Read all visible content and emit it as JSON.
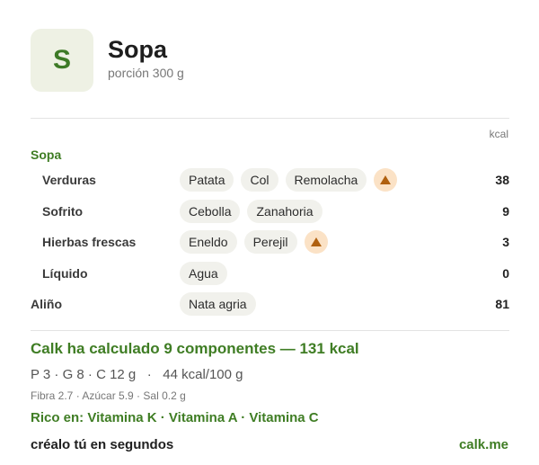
{
  "header": {
    "avatar_letter": "S",
    "title": "Sopa",
    "subtitle": "porción 300 g"
  },
  "table": {
    "kcal_header": "kcal",
    "section_title": "Sopa",
    "rows": [
      {
        "label": "Verduras",
        "chips": [
          "Patata",
          "Col",
          "Remolacha"
        ],
        "warning": true,
        "kcal": "38"
      },
      {
        "label": "Sofrito",
        "chips": [
          "Cebolla",
          "Zanahoria"
        ],
        "warning": false,
        "kcal": "9"
      },
      {
        "label": "Hierbas frescas",
        "chips": [
          "Eneldo",
          "Perejil"
        ],
        "warning": true,
        "kcal": "3"
      },
      {
        "label": "Líquido",
        "chips": [
          "Agua"
        ],
        "warning": false,
        "kcal": "0"
      },
      {
        "label": "Aliño",
        "chips": [
          "Nata agria"
        ],
        "warning": false,
        "kcal": "81"
      }
    ]
  },
  "summary": {
    "headline": "Calk ha calculado 9 componentes — 131 kcal",
    "macros": "P 3 · G 8 · C 12 g   ·   44 kcal/100 g",
    "micros": "Fibra 2.7 · Azúcar 5.9 · Sal 0.2 g",
    "rich_in": "Rico en: Vitamina K · Vitamina A · Vitamina C"
  },
  "footer": {
    "cta": "créalo tú en segundos",
    "link": "calk.me"
  },
  "colors": {
    "accent_green": "#3f7d24",
    "warning_bg": "#fbe2c6",
    "warning_icon": "#b0600f"
  },
  "icons": {
    "warning": "warning-triangle-icon"
  }
}
